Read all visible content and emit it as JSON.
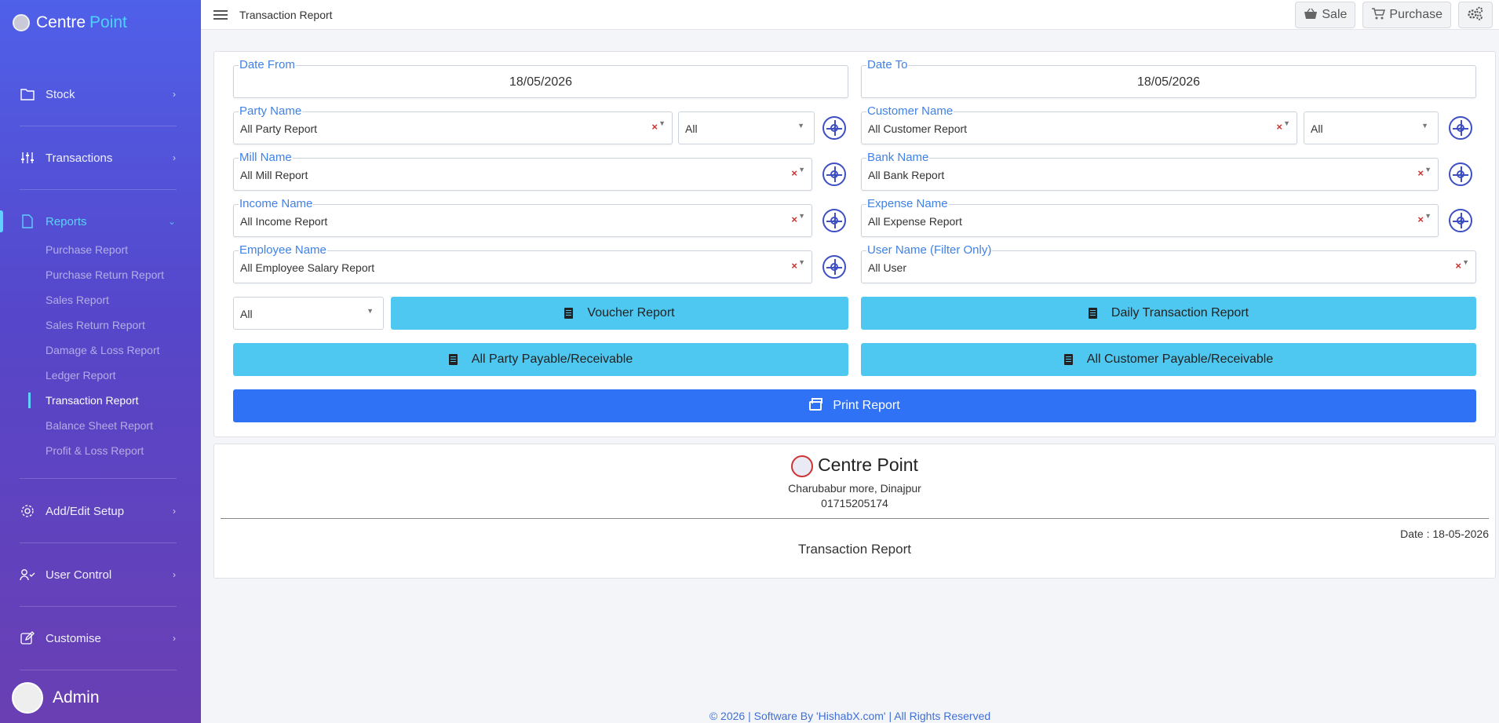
{
  "brand": {
    "name_a": "Centre",
    "name_b": "Point"
  },
  "sidebar": {
    "items": [
      {
        "label": "Stock",
        "icon": "folder-icon"
      },
      {
        "label": "Transactions",
        "icon": "sliders-icon"
      },
      {
        "label": "Reports",
        "icon": "file-icon"
      },
      {
        "label": "Add/Edit Setup",
        "icon": "gear-icon"
      },
      {
        "label": "User Control",
        "icon": "user-check-icon"
      },
      {
        "label": "Customise",
        "icon": "edit-icon"
      }
    ],
    "reports_sub": [
      "Purchase Report",
      "Purchase Return Report",
      "Sales Report",
      "Sales Return Report",
      "Damage & Loss Report",
      "Ledger Report",
      "Transaction Report",
      "Balance Sheet Report",
      "Profit & Loss Report"
    ],
    "user": "Admin"
  },
  "topbar": {
    "title": "Transaction Report",
    "sale_label": "Sale",
    "purchase_label": "Purchase"
  },
  "form": {
    "date_from": {
      "label": "Date From",
      "value": "18/05/2026"
    },
    "date_to": {
      "label": "Date To",
      "value": "18/05/2026"
    },
    "party": {
      "label": "Party Name",
      "value": "All Party Report",
      "filter": "All"
    },
    "customer": {
      "label": "Customer Name",
      "value": "All Customer Report",
      "filter": "All"
    },
    "mill": {
      "label": "Mill Name",
      "value": "All Mill Report"
    },
    "bank": {
      "label": "Bank Name",
      "value": "All Bank Report"
    },
    "income": {
      "label": "Income Name",
      "value": "All Income Report"
    },
    "expense": {
      "label": "Expense Name",
      "value": "All Expense Report"
    },
    "employee": {
      "label": "Employee Name",
      "value": "All Employee Salary Report"
    },
    "user_name": {
      "label": "User Name (Filter Only)",
      "value": "All User"
    },
    "voucher_filter": "All",
    "voucher_button": "Voucher Report",
    "daily_button": "Daily Transaction Report",
    "party_payable_button": "All Party Payable/Receivable",
    "customer_payable_button": "All Customer Payable/Receivable",
    "print_button": "Print Report"
  },
  "report": {
    "company": "Centre Point",
    "address": "Charubabur more, Dinajpur",
    "phone": "01715205174",
    "date": "Date : 18-05-2026",
    "title": "Transaction Report"
  },
  "footer": "© 2026 | Software By 'HishabX.com' | All Rights Reserved",
  "colors": {
    "accent": "#3f82e6",
    "cyan_button": "#4ec8f0",
    "print_button": "#2f72f5"
  }
}
